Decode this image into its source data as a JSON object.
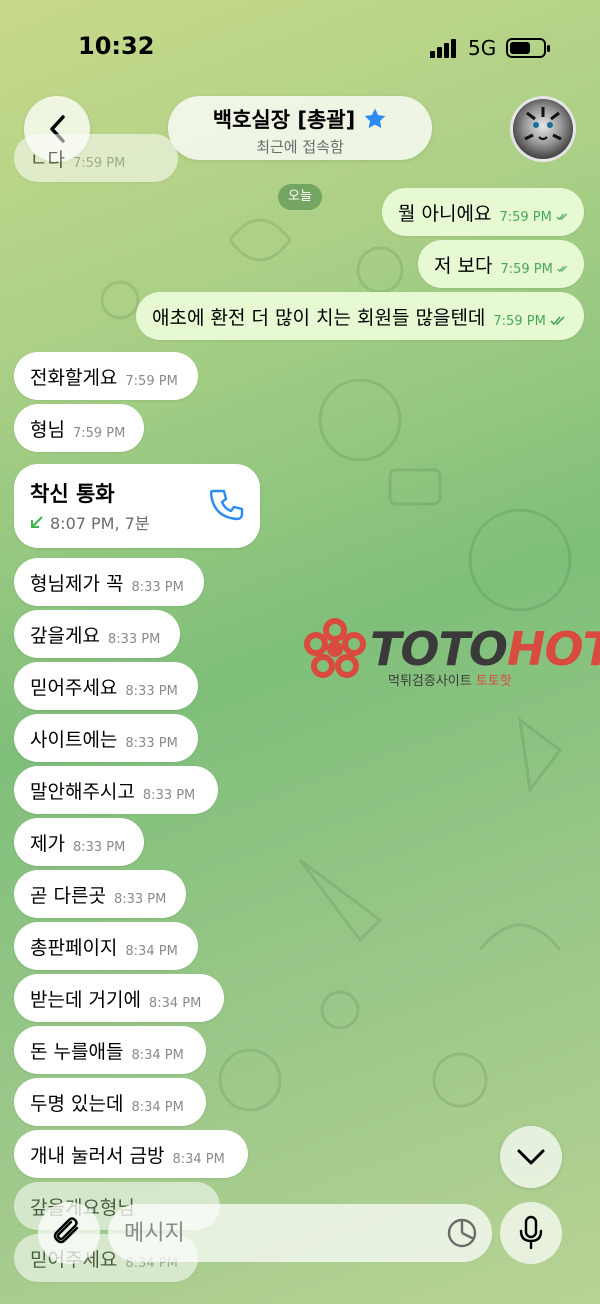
{
  "status_bar": {
    "time": "10:32",
    "network": "5G"
  },
  "header": {
    "title": "백호실장 [총괄]",
    "subtitle": "최근에 접속함"
  },
  "date_badge": "오늘",
  "top_faded": [
    {
      "text": "ㄴ다",
      "time": "7:59 PM"
    }
  ],
  "outgoing": [
    {
      "text": "뭘 아니에요",
      "time": "7:59 PM"
    },
    {
      "text": "저 보다",
      "time": "7:59 PM"
    },
    {
      "text": "애초에 환전 더 많이 치는 회원들 많을텐데",
      "time": "7:59 PM"
    }
  ],
  "incoming_top": [
    {
      "text": "전화할게요",
      "time": "7:59 PM"
    },
    {
      "text": "형님",
      "time": "7:59 PM"
    }
  ],
  "call": {
    "title": "착신 통화",
    "detail": "8:07 PM, 7분"
  },
  "incoming": [
    {
      "text": "형님제가 꼭",
      "time": "8:33 PM"
    },
    {
      "text": "갚을게요",
      "time": "8:33 PM"
    },
    {
      "text": "믿어주세요",
      "time": "8:33 PM"
    },
    {
      "text": "사이트에는",
      "time": "8:33 PM"
    },
    {
      "text": "말안해주시고",
      "time": "8:33 PM"
    },
    {
      "text": "제가",
      "time": "8:33 PM"
    },
    {
      "text": "곧 다른곳",
      "time": "8:33 PM"
    },
    {
      "text": "총판페이지",
      "time": "8:34 PM"
    },
    {
      "text": "받는데 거기에",
      "time": "8:34 PM"
    },
    {
      "text": "돈 누를애들",
      "time": "8:34 PM"
    },
    {
      "text": "두명 있는데",
      "time": "8:34 PM"
    },
    {
      "text": "개내 눌러서 금방",
      "time": "8:34 PM"
    },
    {
      "text": "갚을게요형님",
      "time": ""
    },
    {
      "text": "믿어주세요",
      "time": "8:34 PM"
    }
  ],
  "watermark": {
    "toto": "TOTO",
    "hot": "HOT",
    "sub_main": "먹튀검증사이트",
    "sub_red": "토토핫"
  },
  "input": {
    "placeholder": "메시지"
  }
}
